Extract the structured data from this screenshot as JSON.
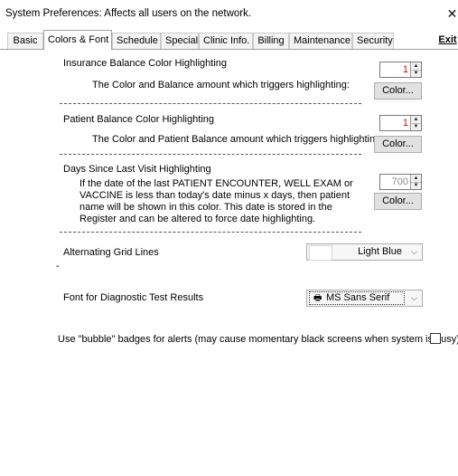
{
  "window": {
    "title": "System Preferences: Affects all users on the network.",
    "close_glyph": "✕"
  },
  "tabs": [
    {
      "label": "Basic"
    },
    {
      "label": "Colors & Font"
    },
    {
      "label": "Schedule"
    },
    {
      "label": "Special"
    },
    {
      "label": "Clinic Info."
    },
    {
      "label": "Billing"
    },
    {
      "label": "Maintenance"
    },
    {
      "label": "Security"
    }
  ],
  "active_tab": "Colors & Font",
  "exit_label": "Exit",
  "insurance": {
    "heading": "Insurance Balance Color Highlighting",
    "description": "The Color and Balance amount which triggers highlighting:",
    "value": "1",
    "color_button": "Color..."
  },
  "patient": {
    "heading": "Patient Balance Color Highlighting",
    "description": "The Color and Patient Balance amount which triggers highlighting:",
    "value": "1",
    "color_button": "Color..."
  },
  "visit": {
    "heading": "Days Since Last Visit Highlighting",
    "description_lines": [
      "If the date of the last  PATIENT ENCOUNTER,  WELL EXAM or",
      "VACCINE is less than today's date minus x days, then patient",
      "name will be shown in this color. This date is stored in the",
      "Register and can be altered to force date highlighting."
    ],
    "value": "700",
    "color_button": "Color..."
  },
  "grid": {
    "label": "Alternating Grid Lines",
    "selected": "Light Blue",
    "dash": "-"
  },
  "font": {
    "label": "Font for Diagnostic Test Results",
    "selected": "MS Sans Serif"
  },
  "bubble": {
    "label": "Use \"bubble\" badges for alerts (may cause momentary black screens when system is busy)",
    "checked": false
  },
  "colors": {
    "value_red": "#d40000",
    "value_gray": "#8a8a8a",
    "swatch_light_blue": "#ffffff"
  }
}
